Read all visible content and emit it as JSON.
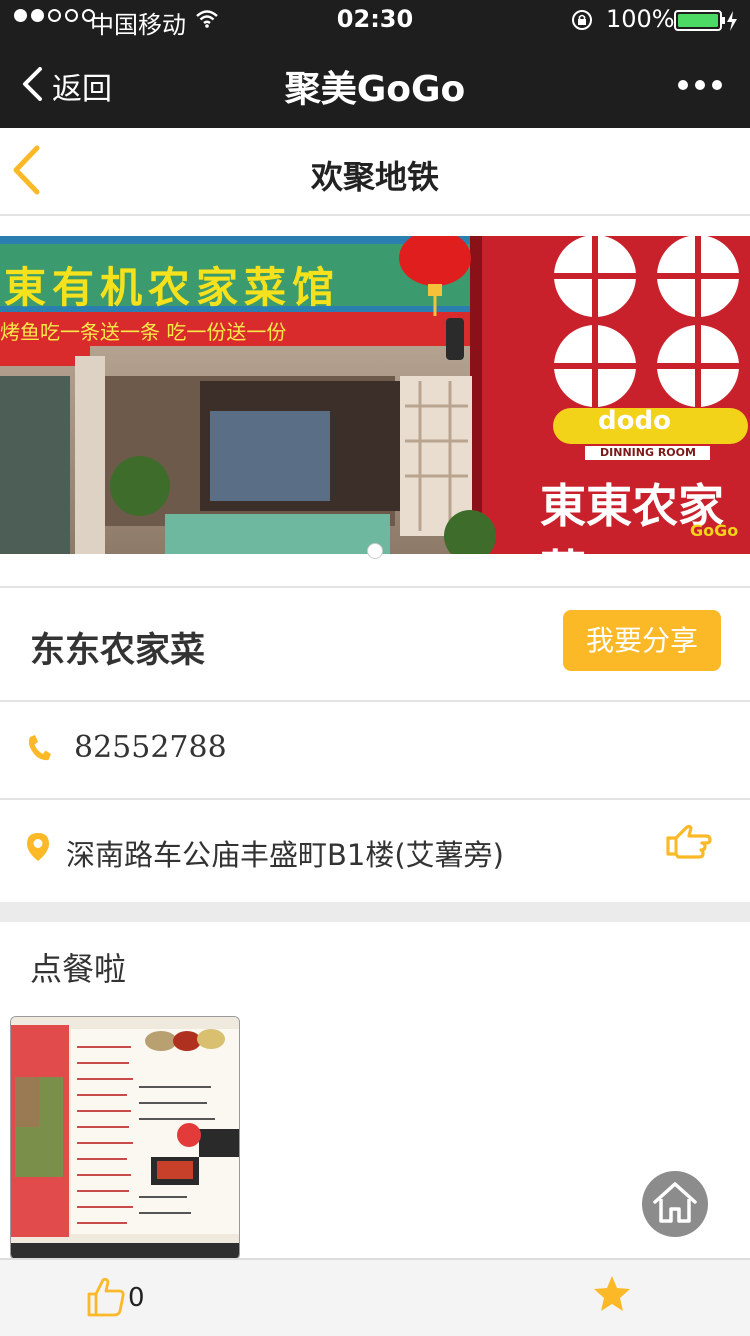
{
  "status_bar": {
    "carrier": "中国移动",
    "time": "02:30",
    "battery_percent": "100%"
  },
  "nav": {
    "back_label": "返回",
    "title": "聚美GoGo"
  },
  "page": {
    "title": "欢聚地铁"
  },
  "banner": {
    "sign_text": "東有机农家菜馆",
    "slogan": "烤鱼吃一条送一条  吃一份送一份",
    "brand_text": "dodo",
    "brand_sub": "DINNING ROOM",
    "brand_name": "東東农家菜",
    "watermark": "GoGo"
  },
  "shop": {
    "name": "东东农家菜",
    "share_label": "我要分享",
    "phone": "82552788",
    "address": "深南路车公庙丰盛町B1楼(艾薯旁)"
  },
  "section": {
    "title": "点餐啦"
  },
  "footer": {
    "like_count": "0"
  },
  "colors": {
    "accent": "#fbb928",
    "nav_bg": "#1e1e1e"
  }
}
